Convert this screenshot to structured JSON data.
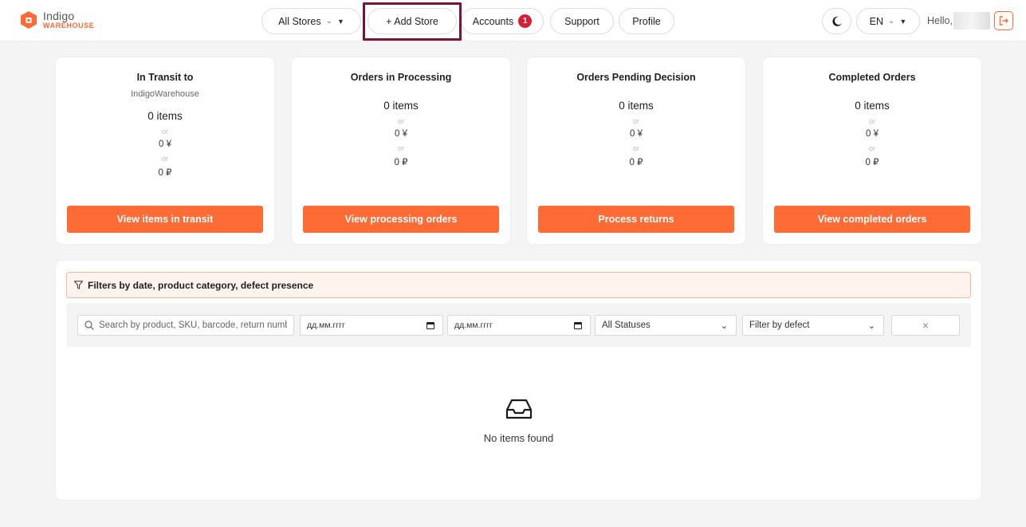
{
  "brand": {
    "name_line1": "Indigo",
    "name_line2": "WAREHOUSE",
    "accent": "#ff6b35"
  },
  "nav": {
    "stores_select": "All Stores",
    "add_store": "+ Add Store",
    "accounts": "Accounts",
    "accounts_badge": "1",
    "support": "Support",
    "profile": "Profile",
    "language": "EN",
    "greeting": "Hello,",
    "theme_icon": "moon-icon",
    "logout_icon": "logout-icon"
  },
  "cards": [
    {
      "title": "In Transit to",
      "subtitle": "IndigoWarehouse",
      "items": "0 items",
      "or1": "or",
      "yen": "0 ¥",
      "or2": "or",
      "rub": "0 ₽",
      "button": "View items in transit"
    },
    {
      "title": "Orders in Processing",
      "items": "0 items",
      "or1": "or",
      "yen": "0 ¥",
      "or2": "or",
      "rub": "0 ₽",
      "button": "View processing orders"
    },
    {
      "title": "Orders Pending Decision",
      "items": "0 items",
      "or1": "or",
      "yen": "0 ¥",
      "or2": "or",
      "rub": "0 ₽",
      "button": "Process returns"
    },
    {
      "title": "Completed Orders",
      "items": "0 items",
      "or1": "or",
      "yen": "0 ¥",
      "or2": "or",
      "rub": "0 ₽",
      "button": "View completed orders"
    }
  ],
  "filters": {
    "header": "Filters by date, product category, defect presence",
    "search_placeholder": "Search by product, SKU, barcode, return number",
    "date_from": "дд.мм.гггг",
    "date_to": "дд.мм.гггг",
    "status": "All Statuses",
    "defect": "Filter by defect",
    "clear_symbol": "×"
  },
  "empty": {
    "icon": "inbox-icon",
    "text": "No items found"
  }
}
